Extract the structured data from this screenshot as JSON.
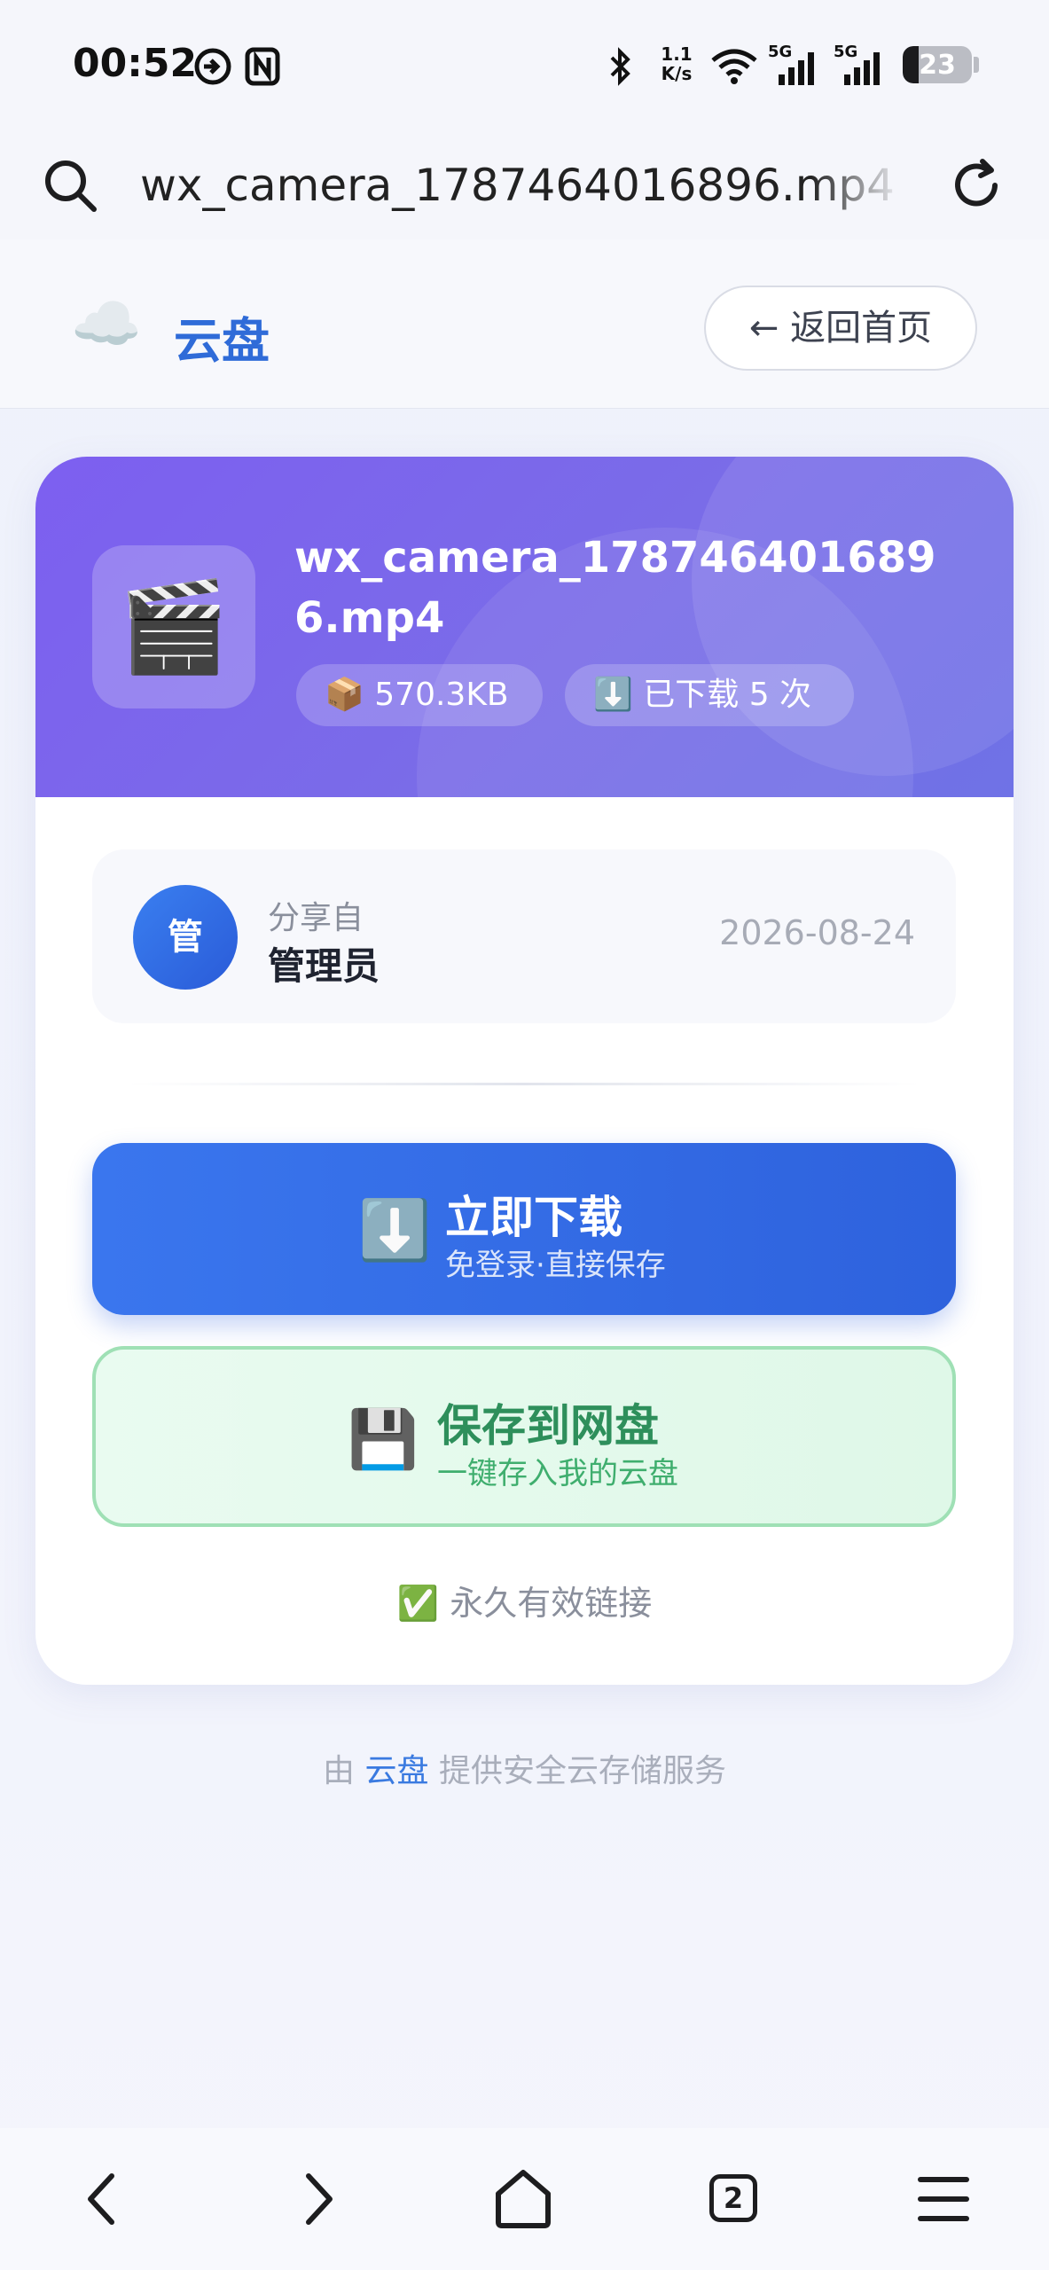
{
  "status_bar": {
    "time": "00:52",
    "net_speed_top": "1.1",
    "net_speed_unit": "K/s",
    "signal1_label": "5G",
    "signal2_label": "5G",
    "battery_level": "23",
    "icons": [
      "nfc-notify-icon",
      "nfc-icon",
      "bluetooth-icon",
      "wifi-icon",
      "signal-icon",
      "signal-icon",
      "battery-icon"
    ]
  },
  "browser": {
    "url_text": "wx_camera_1787464016896.mp4 - ",
    "icons": [
      "search-icon",
      "refresh-icon"
    ]
  },
  "site_header": {
    "brand_icon": "☁️",
    "brand_label": "云盘",
    "back_button_label": "← 返回首页"
  },
  "file": {
    "icon": "🎬",
    "name": "wx_camera_1787464016896.mp4",
    "size_label": "📦 570.3KB",
    "download_count_label": "⬇️ 已下载 5 次"
  },
  "sharer": {
    "avatar_text": "管",
    "from_label": "分享自",
    "name": "管理员",
    "date": "2026-08-24"
  },
  "actions": {
    "download": {
      "icon": "⬇️",
      "label": "立即下载",
      "sub_label": "免登录·直接保存"
    },
    "save": {
      "icon": "💾",
      "label": "保存到网盘",
      "sub_label": "一键存入我的云盘"
    }
  },
  "validity_note": "✅ 永久有效链接",
  "footer": {
    "prefix": "由 ",
    "brand": "云盘",
    "suffix": " 提供安全云存储服务"
  },
  "navbar": {
    "tab_count": "2",
    "icons": [
      "back-arrow-icon",
      "forward-arrow-icon",
      "home-icon",
      "tabs-icon",
      "menu-icon"
    ]
  },
  "colors": {
    "brand_blue": "#2f6bd8",
    "header_purple": "#7d5ff0",
    "download_blue": "#2e62dd",
    "save_green": "#2e8f5b"
  }
}
